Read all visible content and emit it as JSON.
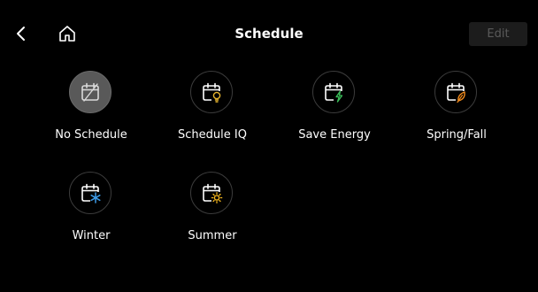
{
  "header": {
    "title": "Schedule",
    "edit_label": "Edit"
  },
  "icons": {
    "back": "chevron-left-icon",
    "home": "home-icon"
  },
  "colors": {
    "background": "#000000",
    "selected_tile": "#595959",
    "bulb_yellow": "#e8b62e",
    "energy_green": "#3bbf5a",
    "leaf_orange": "#f08a1c",
    "snow_blue": "#3c9be8",
    "sun_yellow": "#f2b51d"
  },
  "schedules": [
    {
      "label": "No Schedule",
      "icon": "calendar-slash-icon",
      "selected": true
    },
    {
      "label": "Schedule IQ",
      "icon": "calendar-bulb-icon",
      "selected": false
    },
    {
      "label": "Save Energy",
      "icon": "calendar-bolt-icon",
      "selected": false
    },
    {
      "label": "Spring/Fall",
      "icon": "calendar-leaf-icon",
      "selected": false
    },
    {
      "label": "Winter",
      "icon": "calendar-snowflake-icon",
      "selected": false
    },
    {
      "label": "Summer",
      "icon": "calendar-sun-icon",
      "selected": false
    }
  ]
}
